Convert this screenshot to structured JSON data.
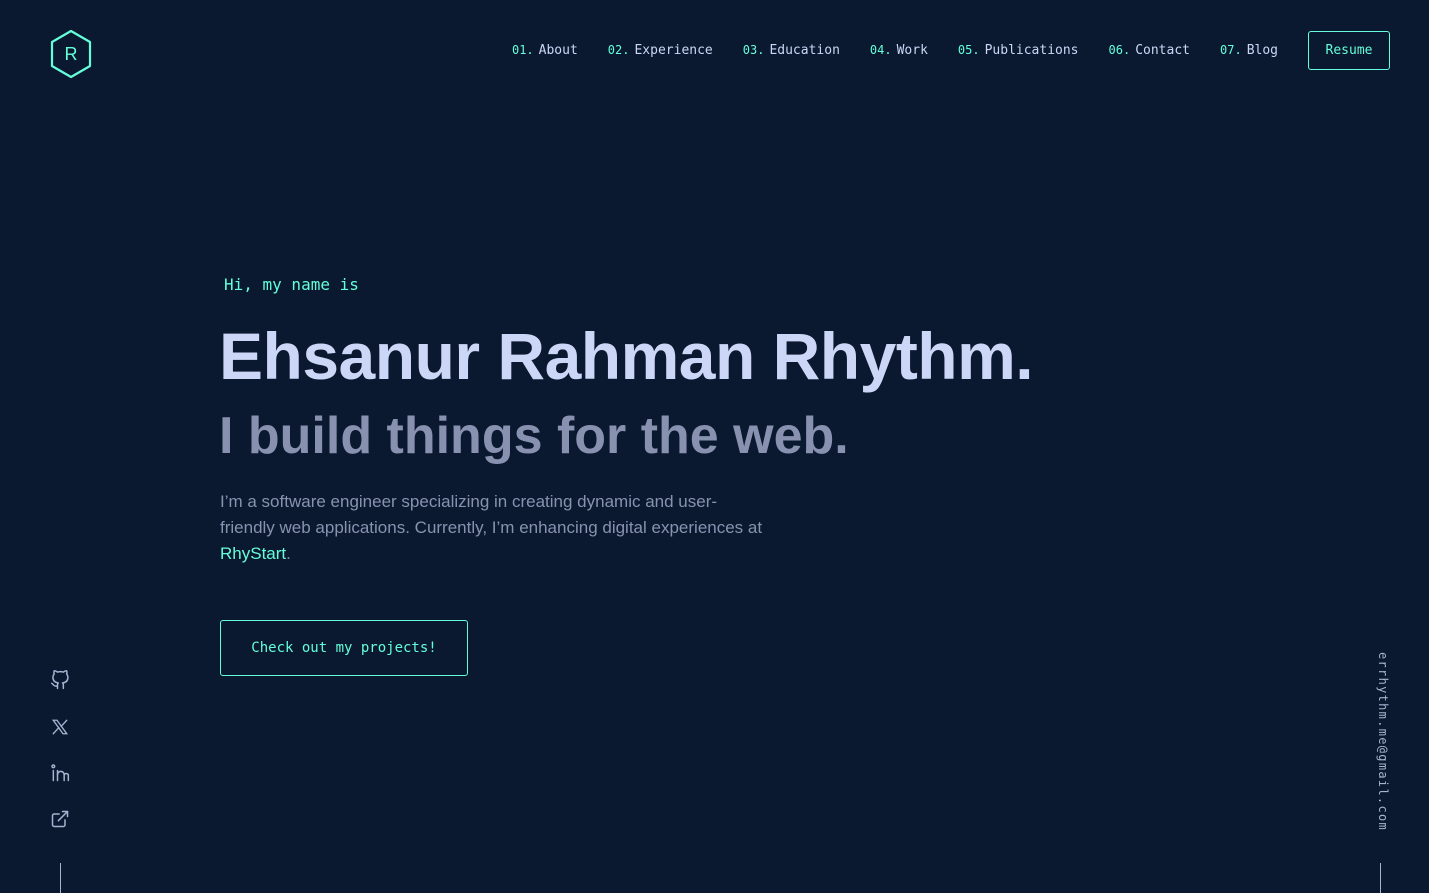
{
  "logo": {
    "letter": "R"
  },
  "nav": {
    "items": [
      {
        "num": "01.",
        "label": "About"
      },
      {
        "num": "02.",
        "label": "Experience"
      },
      {
        "num": "03.",
        "label": "Education"
      },
      {
        "num": "04.",
        "label": "Work"
      },
      {
        "num": "05.",
        "label": "Publications"
      },
      {
        "num": "06.",
        "label": "Contact"
      },
      {
        "num": "07.",
        "label": "Blog"
      }
    ],
    "resume_label": "Resume"
  },
  "hero": {
    "greeting": "Hi, my name is",
    "name": "Ehsanur Rahman Rhythm.",
    "tagline": "I build things for the web.",
    "intro_text": "I’m a software engineer specializing in creating dynamic and user-friendly web applications. Currently, I’m enhancing digital experiences at ",
    "intro_link": "RhyStart",
    "intro_end": ".",
    "cta_label": "Check out my projects!"
  },
  "social": {
    "icons": [
      "github-icon",
      "x-twitter-icon",
      "linkedin-icon",
      "external-link-icon"
    ]
  },
  "email": "errhythm.me@gmail.com",
  "colors": {
    "background": "#0a192f",
    "accent": "#64ffda",
    "heading": "#ccd6f6",
    "text": "#8892b0"
  }
}
